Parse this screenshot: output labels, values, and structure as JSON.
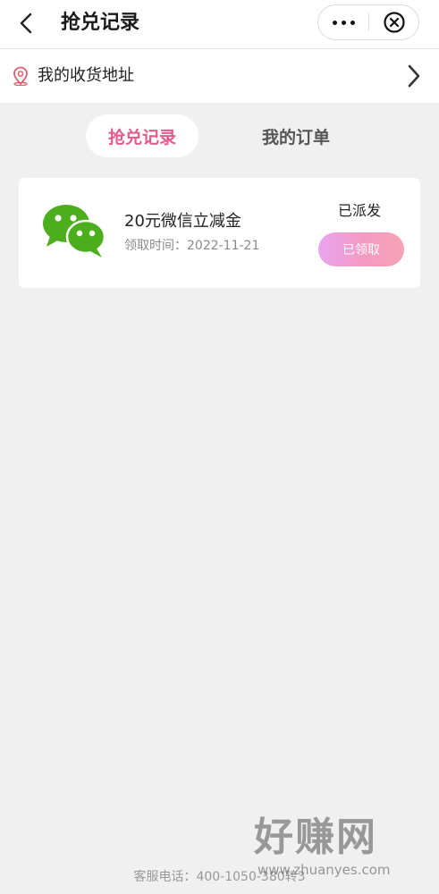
{
  "nav": {
    "title": "抢兑记录",
    "back_icon": "back-arrow-icon",
    "more_icon": "more-dots-icon",
    "close_icon": "close-circle-icon"
  },
  "address": {
    "label": "我的收货地址",
    "icon": "location-pin-icon",
    "accent": "#e06070"
  },
  "tabs": [
    {
      "label": "抢兑记录",
      "active": true
    },
    {
      "label": "我的订单",
      "active": false
    }
  ],
  "records": [
    {
      "icon": "wechat-icon",
      "name": "20元微信立减金",
      "time_label": "领取时间：",
      "time_value": "2022-11-21",
      "status": "已派发",
      "button_label": "已领取"
    }
  ],
  "footer": {
    "service_phone": "客服电话：400-1050-380转3"
  },
  "watermark": {
    "title": "好赚网",
    "url": "www.zhuanyes.com"
  },
  "colors": {
    "accent_pink": "#e35a8c",
    "wechat_green": "#4cae1c",
    "background": "#f0f0f0"
  }
}
